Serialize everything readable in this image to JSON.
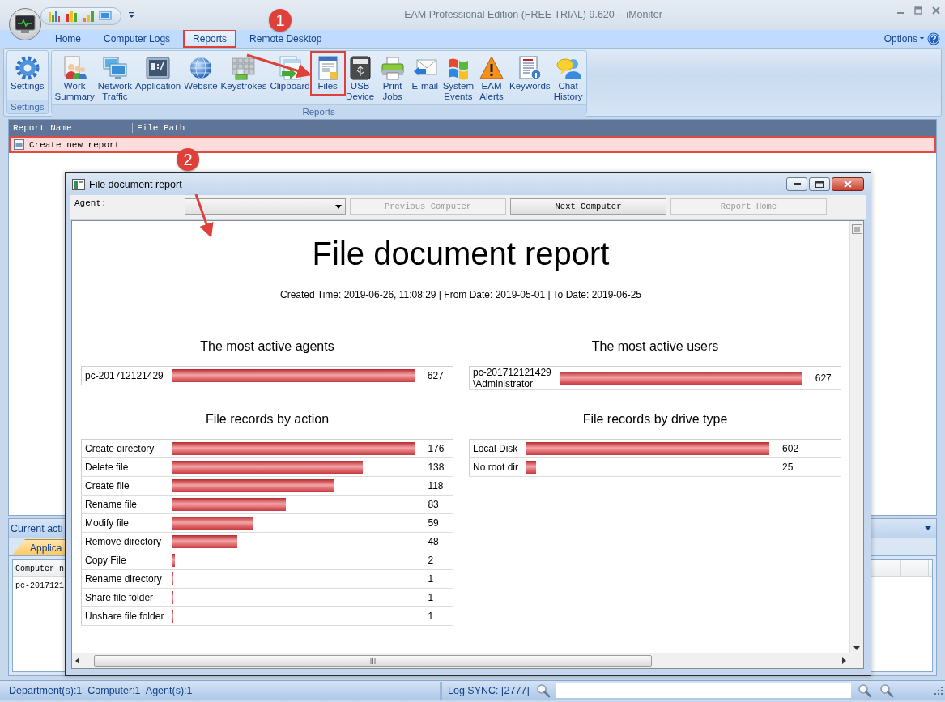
{
  "window": {
    "title": "EAM Professional Edition (FREE TRIAL) 9.620 -  iMonitor"
  },
  "ribbon": {
    "tabs": [
      {
        "label": "Home",
        "selected": false,
        "highlighted": false
      },
      {
        "label": "Computer Logs",
        "selected": false,
        "highlighted": false
      },
      {
        "label": "Reports",
        "selected": true,
        "highlighted": true
      },
      {
        "label": "Remote Desktop",
        "selected": false,
        "highlighted": false
      }
    ],
    "options": "Options",
    "groups": [
      {
        "label": "Settings",
        "buttons": [
          {
            "label": "Settings",
            "highlighted": false
          }
        ]
      },
      {
        "label": "Reports",
        "buttons": [
          {
            "label": "Work\nSummary",
            "highlighted": false
          },
          {
            "label": "Network\nTraffic",
            "highlighted": false
          },
          {
            "label": "Application",
            "highlighted": false
          },
          {
            "label": "Website",
            "highlighted": false
          },
          {
            "label": "Keystrokes",
            "highlighted": false
          },
          {
            "label": "Clipboard",
            "highlighted": false
          },
          {
            "label": "Files",
            "highlighted": true
          },
          {
            "label": "USB\nDevice",
            "highlighted": false
          },
          {
            "label": "Print\nJobs",
            "highlighted": false
          },
          {
            "label": "E-mail",
            "highlighted": false
          },
          {
            "label": "System\nEvents",
            "highlighted": false
          },
          {
            "label": "EAM\nAlerts",
            "highlighted": false
          },
          {
            "label": "Keywords",
            "highlighted": false
          },
          {
            "label": "Chat\nHistory",
            "highlighted": false
          }
        ]
      }
    ]
  },
  "report_list": {
    "columns": [
      "Report Name",
      "File Path"
    ],
    "rows": [
      {
        "name": "Create new report",
        "selected": true
      }
    ]
  },
  "activity_panel": {
    "title": "Current acti",
    "tabs": [
      {
        "label": "Applica",
        "selected": true
      }
    ],
    "columns": [
      "Computer n"
    ],
    "rows": [
      {
        "cells": [
          "pc-2017121"
        ]
      }
    ]
  },
  "dialog": {
    "title": "File document report",
    "agent_label": "Agent:",
    "buttons": [
      {
        "label": "Previous Computer",
        "disabled": true
      },
      {
        "label": "Next Computer",
        "disabled": false
      },
      {
        "label": "Report Home",
        "disabled": true
      }
    ],
    "report": {
      "title": "File document report",
      "subtitle": "Created Time: 2019-06-26, 11:08:29 | From Date: 2019-05-01 | To Date: 2019-06-25",
      "sections": [
        {
          "title": "The most active agents",
          "rows": [
            {
              "name": "pc-201712121429",
              "value": "627",
              "level": 1
            }
          ]
        },
        {
          "title": "The most active users",
          "rows": [
            {
              "name": "pc-201712121429\n\\Administrator",
              "value": "627",
              "level": 1
            }
          ]
        },
        {
          "title": "File records by action",
          "rows": [
            {
              "name": "Create directory",
              "value": "176",
              "level": 1
            },
            {
              "name": "Delete file",
              "value": "138",
              "level": 0.784
            },
            {
              "name": "Create file",
              "value": "118",
              "level": 0.67
            },
            {
              "name": "Rename file",
              "value": "83",
              "level": 0.47
            },
            {
              "name": "Modify file",
              "value": "59",
              "level": 0.335
            },
            {
              "name": "Remove directory",
              "value": "48",
              "level": 0.27
            },
            {
              "name": "Copy File",
              "value": "2",
              "level": 0.011
            },
            {
              "name": "Rename directory",
              "value": "1",
              "level": 0.006
            },
            {
              "name": "Share file folder",
              "value": "1",
              "level": 0.006
            },
            {
              "name": "Unshare file folder",
              "value": "1",
              "level": 0.006
            }
          ]
        },
        {
          "title": "File records by drive type",
          "rows": [
            {
              "name": "Local Disk",
              "value": "602",
              "level": 1
            },
            {
              "name": "No root dir",
              "value": "25",
              "level": 0.04
            }
          ]
        }
      ]
    }
  },
  "annotations": [
    {
      "label": "1"
    },
    {
      "label": "2"
    }
  ],
  "status_bar": {
    "counts": "Department(s):1  Computer:1  Agent(s):1",
    "log_sync": "Log SYNC: [2777]"
  }
}
